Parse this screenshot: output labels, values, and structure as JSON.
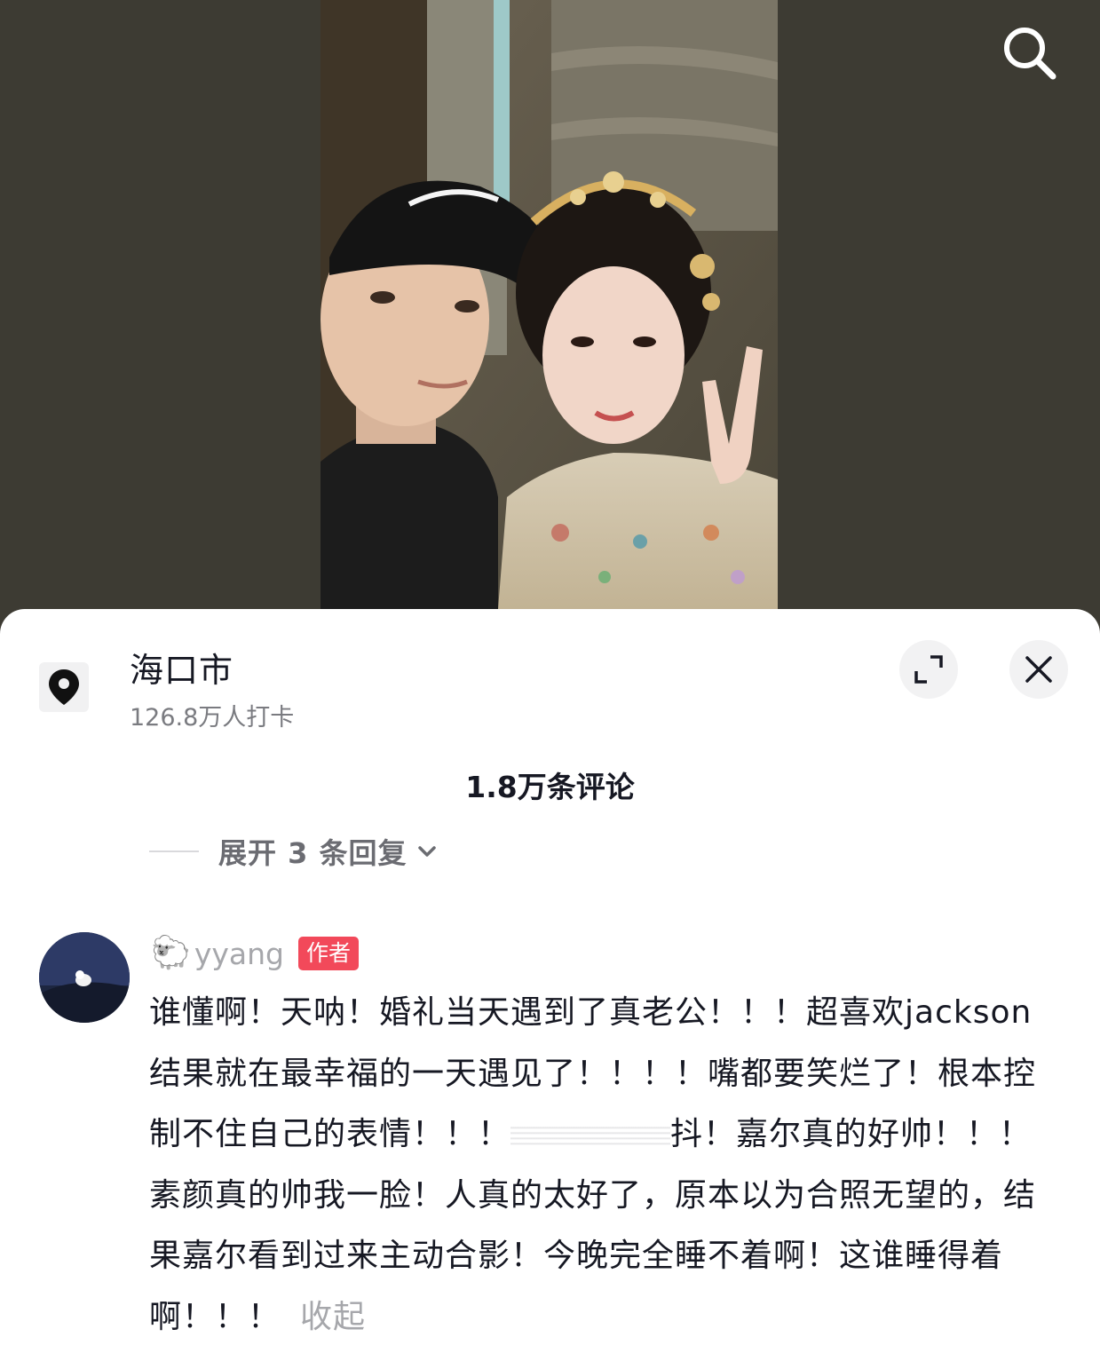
{
  "video": {
    "search_icon": "search-icon"
  },
  "location": {
    "icon": "location-pin-icon",
    "name": "海口市",
    "checkins": "126.8万人打卡"
  },
  "sheet_controls": {
    "expand_icon": "expand-icon",
    "close_icon": "close-icon"
  },
  "comments": {
    "count_label": "1.8万条评论",
    "expand_replies_label": "展开 3 条回复",
    "chevron_icon": "chevron-down-icon"
  },
  "comment": {
    "user_emoji": "🐑",
    "username": "yyang",
    "author_badge": "作者",
    "text_part1": "谁懂啊！天呐！婚礼当天遇到了真老公！！！超喜欢jackson 结果就在最幸福的一天遇见了！！！！嘴都要笑烂了！根本控制不住自己的表情！！！",
    "text_part2": "抖！嘉尔真的好帅！！！素颜真的帅我一脸！人真的太好了，原本以为合照无望的，结果嘉尔看到过来主动合影！今晚完全睡不着啊！这谁睡得着啊！！！",
    "collapse_label": "收起"
  },
  "colors": {
    "video_bg": "#3d3b33",
    "badge_red": "#f2495a",
    "text_primary": "#161823",
    "text_secondary": "#7a7b80"
  }
}
